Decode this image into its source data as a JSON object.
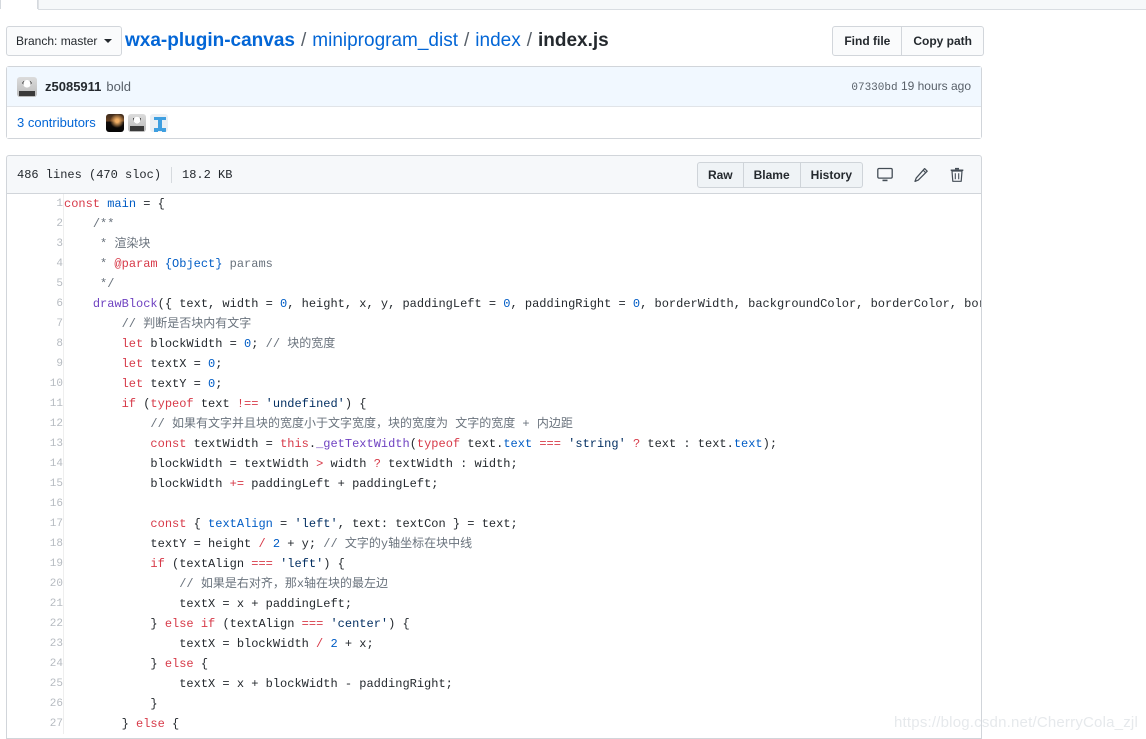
{
  "header": {
    "branch_button": "Branch: master",
    "branch_caret_icon": "chevron-down-icon",
    "breadcrumb": {
      "repo": "wxa-plugin-canvas",
      "separator": "/",
      "segments": [
        "miniprogram_dist",
        "index"
      ],
      "file": "index.js"
    },
    "find_file_button": "Find file",
    "copy_path_button": "Copy path"
  },
  "commit": {
    "avatar_icon": "user-avatar-cartoon",
    "author": "z5085911",
    "message": "bold",
    "sha": "07330bd",
    "time": "19 hours ago"
  },
  "contributors": {
    "label": "3 contributors",
    "avatars": [
      "avatar-photo-sunset",
      "avatar-cartoon-gray",
      "avatar-blue-glyph"
    ]
  },
  "file_meta": {
    "lines": "486 lines (470 sloc)",
    "size": "18.2 KB",
    "raw_button": "Raw",
    "blame_button": "Blame",
    "history_button": "History",
    "desktop_icon": "desktop-download-icon",
    "edit_icon": "pencil-edit-icon",
    "delete_icon": "trash-delete-icon"
  },
  "code": {
    "lines": [
      {
        "n": "1",
        "tokens": [
          {
            "t": "const ",
            "c": "k"
          },
          {
            "t": "main",
            "c": "e"
          },
          {
            "t": " = {",
            "c": "p"
          }
        ]
      },
      {
        "n": "2",
        "tokens": [
          {
            "t": "    ",
            "c": "p"
          },
          {
            "t": "/**",
            "c": "c"
          }
        ]
      },
      {
        "n": "3",
        "tokens": [
          {
            "t": "     ",
            "c": "p"
          },
          {
            "t": "* 渲染块",
            "c": "c"
          }
        ]
      },
      {
        "n": "4",
        "tokens": [
          {
            "t": "     ",
            "c": "p"
          },
          {
            "t": "* ",
            "c": "c"
          },
          {
            "t": "@param",
            "c": "k"
          },
          {
            "t": " ",
            "c": "c"
          },
          {
            "t": "{Object}",
            "c": "e"
          },
          {
            "t": " params",
            "c": "c"
          }
        ]
      },
      {
        "n": "5",
        "tokens": [
          {
            "t": "     ",
            "c": "p"
          },
          {
            "t": "*/",
            "c": "c"
          }
        ]
      },
      {
        "n": "6",
        "tokens": [
          {
            "t": "    ",
            "c": "p"
          },
          {
            "t": "drawBlock",
            "c": "f"
          },
          {
            "t": "({ text, width = ",
            "c": "p"
          },
          {
            "t": "0",
            "c": "n"
          },
          {
            "t": ", height, x, y, paddingLeft = ",
            "c": "p"
          },
          {
            "t": "0",
            "c": "n"
          },
          {
            "t": ", paddingRight = ",
            "c": "p"
          },
          {
            "t": "0",
            "c": "n"
          },
          {
            "t": ", borderWidth, backgroundColor, borderColor, borderRadius =",
            "c": "p"
          }
        ]
      },
      {
        "n": "7",
        "tokens": [
          {
            "t": "        ",
            "c": "p"
          },
          {
            "t": "// 判断是否块内有文字",
            "c": "c"
          }
        ]
      },
      {
        "n": "8",
        "tokens": [
          {
            "t": "        ",
            "c": "p"
          },
          {
            "t": "let",
            "c": "k"
          },
          {
            "t": " blockWidth = ",
            "c": "p"
          },
          {
            "t": "0",
            "c": "n"
          },
          {
            "t": "; ",
            "c": "p"
          },
          {
            "t": "// 块的宽度",
            "c": "c"
          }
        ]
      },
      {
        "n": "9",
        "tokens": [
          {
            "t": "        ",
            "c": "p"
          },
          {
            "t": "let",
            "c": "k"
          },
          {
            "t": " textX = ",
            "c": "p"
          },
          {
            "t": "0",
            "c": "n"
          },
          {
            "t": ";",
            "c": "p"
          }
        ]
      },
      {
        "n": "10",
        "tokens": [
          {
            "t": "        ",
            "c": "p"
          },
          {
            "t": "let",
            "c": "k"
          },
          {
            "t": " textY = ",
            "c": "p"
          },
          {
            "t": "0",
            "c": "n"
          },
          {
            "t": ";",
            "c": "p"
          }
        ]
      },
      {
        "n": "11",
        "tokens": [
          {
            "t": "        ",
            "c": "p"
          },
          {
            "t": "if",
            "c": "k"
          },
          {
            "t": " (",
            "c": "p"
          },
          {
            "t": "typeof",
            "c": "k"
          },
          {
            "t": " text ",
            "c": "p"
          },
          {
            "t": "!==",
            "c": "k"
          },
          {
            "t": " ",
            "c": "p"
          },
          {
            "t": "'undefined'",
            "c": "s"
          },
          {
            "t": ") {",
            "c": "p"
          }
        ]
      },
      {
        "n": "12",
        "tokens": [
          {
            "t": "            ",
            "c": "p"
          },
          {
            "t": "// 如果有文字并且块的宽度小于文字宽度，块的宽度为 文字的宽度 + 内边距",
            "c": "c"
          }
        ]
      },
      {
        "n": "13",
        "tokens": [
          {
            "t": "            ",
            "c": "p"
          },
          {
            "t": "const",
            "c": "k"
          },
          {
            "t": " textWidth = ",
            "c": "p"
          },
          {
            "t": "this",
            "c": "k"
          },
          {
            "t": ".",
            "c": "p"
          },
          {
            "t": "_getTextWidth",
            "c": "f"
          },
          {
            "t": "(",
            "c": "p"
          },
          {
            "t": "typeof",
            "c": "k"
          },
          {
            "t": " text.",
            "c": "p"
          },
          {
            "t": "text",
            "c": "e"
          },
          {
            "t": " ",
            "c": "p"
          },
          {
            "t": "===",
            "c": "k"
          },
          {
            "t": " ",
            "c": "p"
          },
          {
            "t": "'string'",
            "c": "s"
          },
          {
            "t": " ",
            "c": "p"
          },
          {
            "t": "?",
            "c": "k"
          },
          {
            "t": " text : text.",
            "c": "p"
          },
          {
            "t": "text",
            "c": "e"
          },
          {
            "t": ");",
            "c": "p"
          }
        ]
      },
      {
        "n": "14",
        "tokens": [
          {
            "t": "            ",
            "c": "p"
          },
          {
            "t": "blockWidth = textWidth ",
            "c": "p"
          },
          {
            "t": ">",
            "c": "k"
          },
          {
            "t": " width ",
            "c": "p"
          },
          {
            "t": "?",
            "c": "k"
          },
          {
            "t": " textWidth : width;",
            "c": "p"
          }
        ]
      },
      {
        "n": "15",
        "tokens": [
          {
            "t": "            ",
            "c": "p"
          },
          {
            "t": "blockWidth ",
            "c": "p"
          },
          {
            "t": "+=",
            "c": "k"
          },
          {
            "t": " paddingLeft + paddingLeft;",
            "c": "p"
          }
        ]
      },
      {
        "n": "16",
        "tokens": [
          {
            "t": "",
            "c": "p"
          }
        ]
      },
      {
        "n": "17",
        "tokens": [
          {
            "t": "            ",
            "c": "p"
          },
          {
            "t": "const",
            "c": "k"
          },
          {
            "t": " { ",
            "c": "p"
          },
          {
            "t": "textAlign",
            "c": "e"
          },
          {
            "t": " = ",
            "c": "p"
          },
          {
            "t": "'left'",
            "c": "s"
          },
          {
            "t": ", text: textCon } = text;",
            "c": "p"
          }
        ]
      },
      {
        "n": "18",
        "tokens": [
          {
            "t": "            ",
            "c": "p"
          },
          {
            "t": "textY = height ",
            "c": "p"
          },
          {
            "t": "/",
            "c": "k"
          },
          {
            "t": " ",
            "c": "p"
          },
          {
            "t": "2",
            "c": "n"
          },
          {
            "t": " + y; ",
            "c": "p"
          },
          {
            "t": "// 文字的y轴坐标在块中线",
            "c": "c"
          }
        ]
      },
      {
        "n": "19",
        "tokens": [
          {
            "t": "            ",
            "c": "p"
          },
          {
            "t": "if",
            "c": "k"
          },
          {
            "t": " (textAlign ",
            "c": "p"
          },
          {
            "t": "===",
            "c": "k"
          },
          {
            "t": " ",
            "c": "p"
          },
          {
            "t": "'left'",
            "c": "s"
          },
          {
            "t": ") {",
            "c": "p"
          }
        ]
      },
      {
        "n": "20",
        "tokens": [
          {
            "t": "                ",
            "c": "p"
          },
          {
            "t": "// 如果是右对齐，那x轴在块的最左边",
            "c": "c"
          }
        ]
      },
      {
        "n": "21",
        "tokens": [
          {
            "t": "                ",
            "c": "p"
          },
          {
            "t": "textX = x + paddingLeft;",
            "c": "p"
          }
        ]
      },
      {
        "n": "22",
        "tokens": [
          {
            "t": "            ",
            "c": "p"
          },
          {
            "t": "} ",
            "c": "p"
          },
          {
            "t": "else",
            "c": "k"
          },
          {
            "t": " ",
            "c": "p"
          },
          {
            "t": "if",
            "c": "k"
          },
          {
            "t": " (textAlign ",
            "c": "p"
          },
          {
            "t": "===",
            "c": "k"
          },
          {
            "t": " ",
            "c": "p"
          },
          {
            "t": "'center'",
            "c": "s"
          },
          {
            "t": ") {",
            "c": "p"
          }
        ]
      },
      {
        "n": "23",
        "tokens": [
          {
            "t": "                ",
            "c": "p"
          },
          {
            "t": "textX = blockWidth ",
            "c": "p"
          },
          {
            "t": "/",
            "c": "k"
          },
          {
            "t": " ",
            "c": "p"
          },
          {
            "t": "2",
            "c": "n"
          },
          {
            "t": " + x;",
            "c": "p"
          }
        ]
      },
      {
        "n": "24",
        "tokens": [
          {
            "t": "            ",
            "c": "p"
          },
          {
            "t": "} ",
            "c": "p"
          },
          {
            "t": "else",
            "c": "k"
          },
          {
            "t": " {",
            "c": "p"
          }
        ]
      },
      {
        "n": "25",
        "tokens": [
          {
            "t": "                ",
            "c": "p"
          },
          {
            "t": "textX = x + blockWidth - paddingRight;",
            "c": "p"
          }
        ]
      },
      {
        "n": "26",
        "tokens": [
          {
            "t": "            ",
            "c": "p"
          },
          {
            "t": "}",
            "c": "p"
          }
        ]
      },
      {
        "n": "27",
        "tokens": [
          {
            "t": "        ",
            "c": "p"
          },
          {
            "t": "} ",
            "c": "p"
          },
          {
            "t": "else",
            "c": "k"
          },
          {
            "t": " {",
            "c": "p"
          }
        ]
      }
    ]
  },
  "watermark": "https://blog.csdn.net/CherryCola_zjl",
  "colors": {
    "link": "#0366d6",
    "commit_bar_bg": "#f1f8ff",
    "meta_bar_bg": "#f6f8fa",
    "border": "#d1d5da",
    "keyword": "#d73a49",
    "string": "#032f62",
    "comment": "#6a737d",
    "entity": "#005cc5",
    "function": "#6f42c1"
  }
}
